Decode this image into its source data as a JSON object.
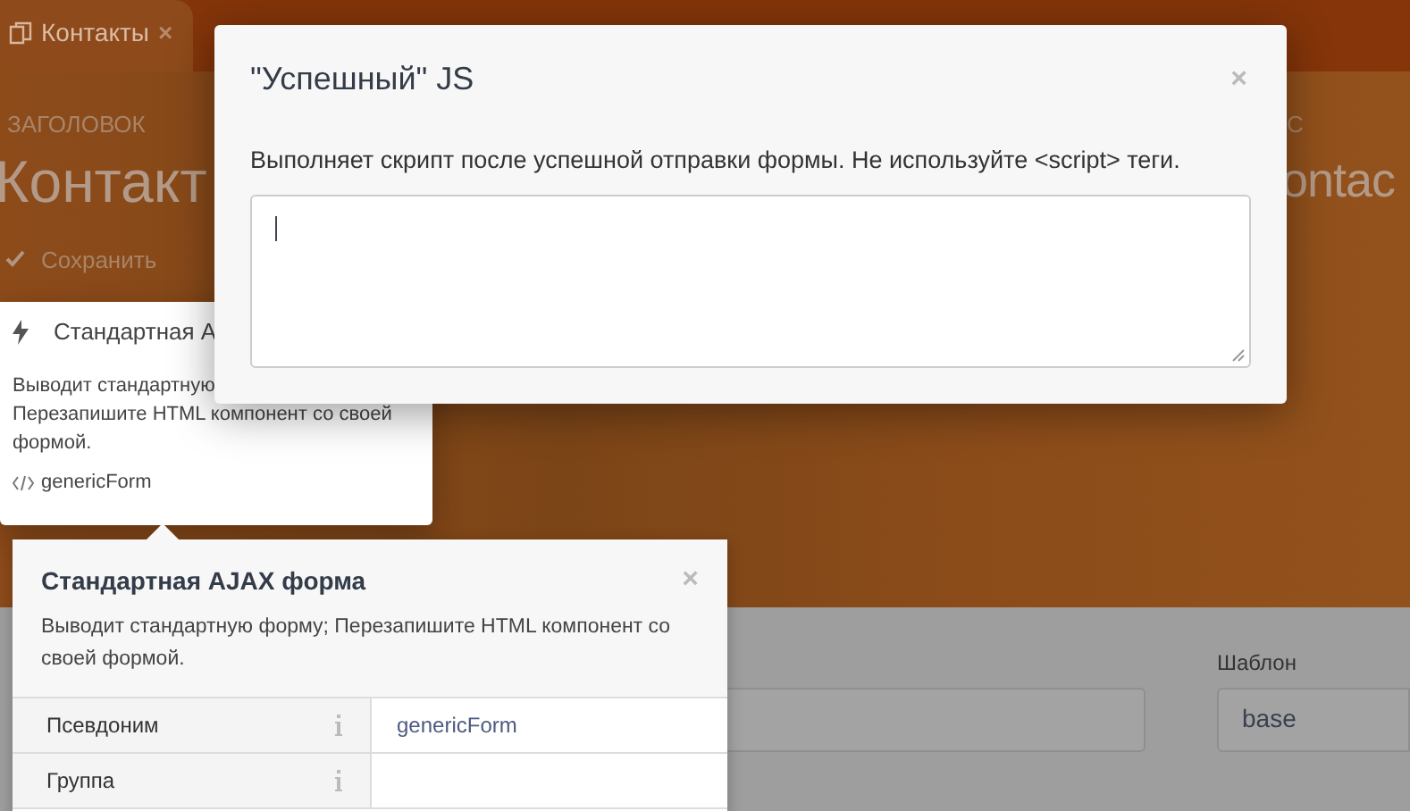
{
  "tab": {
    "label": "Контакты",
    "close": "×"
  },
  "header": {
    "label": "ЗАГОЛОВОК",
    "title": "Контакт",
    "save": "Сохранить",
    "right_label": "С",
    "right_title": "ontac"
  },
  "component_card": {
    "title": "Стандартная A",
    "description_lines": [
      "Выводит стандартную",
      "Перезапишите HTML компонент со своей",
      "формой."
    ],
    "alias": "genericForm"
  },
  "form": {
    "template_label": "Шаблон",
    "template_value": "base"
  },
  "popover": {
    "title": "Стандартная AJAX форма",
    "close": "×",
    "description": "Выводит стандартную форму; Перезапишите HTML компонент со своей формой.",
    "properties": [
      {
        "name": "Псевдоним",
        "value": "genericForm"
      },
      {
        "name": "Группа"
      }
    ]
  },
  "modal": {
    "title": "\"Успешный\" JS",
    "close": "×",
    "description": "Выполняет скрипт после успешной отправки формы. Не используйте <script> теги."
  }
}
